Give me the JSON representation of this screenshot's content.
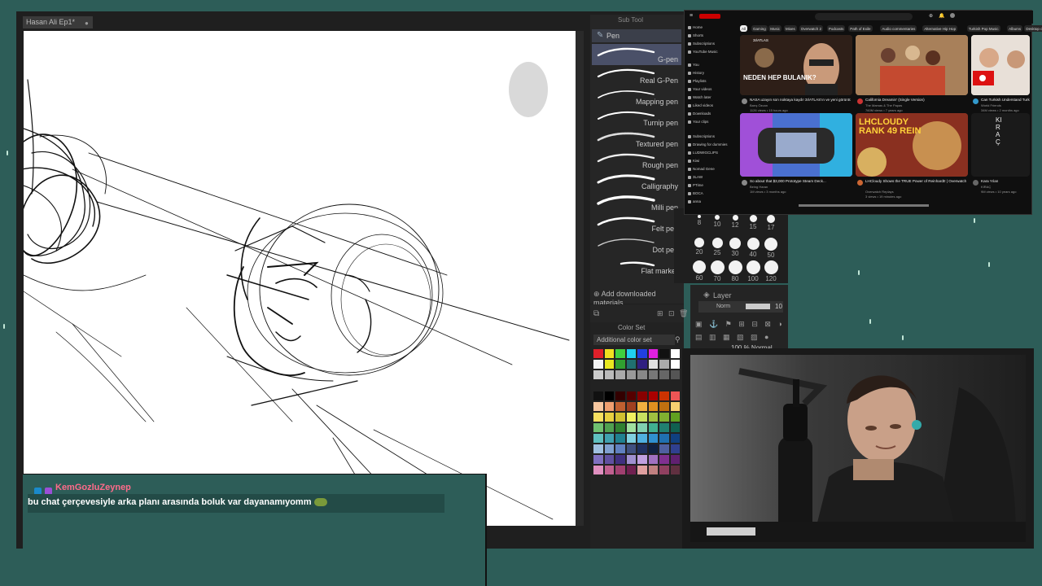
{
  "csp": {
    "document_tab": "Hasan Ali Ep1*",
    "document_tab_close": "●",
    "subtool_title": "Sub Tool",
    "pen_group": "Pen",
    "brushes": [
      {
        "label": "G-pen",
        "selected": true
      },
      {
        "label": "Real G-Pen",
        "selected": false
      },
      {
        "label": "Mapping pen",
        "selected": false
      },
      {
        "label": "Turnip pen",
        "selected": false
      },
      {
        "label": "Textured pen",
        "selected": false
      },
      {
        "label": "Rough pen",
        "selected": false
      },
      {
        "label": "Calligraphy",
        "selected": false
      },
      {
        "label": "Milli pen",
        "selected": false
      },
      {
        "label": "Felt pen",
        "selected": false
      },
      {
        "label": "Dot pen",
        "selected": false
      },
      {
        "label": "Flat marker",
        "selected": false
      }
    ],
    "add_materials": "Add downloaded materials",
    "color_set_title": "Color Set",
    "color_set_name": "Additional color set",
    "brush_sizes": [
      "8",
      "10",
      "12",
      "15",
      "17",
      "20",
      "25",
      "30",
      "40",
      "50",
      "60",
      "70",
      "80",
      "100",
      "120"
    ],
    "layer_title": "Layer",
    "layer_opacity": "100 % Normal",
    "layer_value": "10",
    "layer_blend": "Norm"
  },
  "youtube": {
    "chips": [
      "All",
      "Gaming",
      "Music",
      "Mixes",
      "Overwatch 2",
      "Podcasts",
      "Path of Exile",
      "Audio commentaries",
      "Alternative Hip Hop",
      "Turkish Pop Music",
      "Albums",
      "Desktop computers"
    ],
    "sidebar": [
      "Home",
      "Shorts",
      "Subscriptions",
      "YouTube Music",
      "You",
      "History",
      "Playlists",
      "Your videos",
      "Watch later",
      "Liked videos",
      "Downloads",
      "Your clips",
      "Subscriptions",
      "Drawing for dummies",
      "LUDWIGCLIPS",
      "Kiwi",
      "Nomad Gene",
      "3LAW",
      "PTime",
      "BOCA",
      "anna"
    ],
    "videos": [
      {
        "title": "NASA uzayın son noktaya kaydı! 3I/ATLAS'ın ve yeni görüntüler!",
        "channel": "Barış Özcan",
        "meta": "1126 views • 15 hours ago",
        "thumb_text": "NEDEN HEP BULANIK?",
        "thumb_small": "3I/ATLAS"
      },
      {
        "title": "California Dreamin' (Single Version)",
        "channel": "The Mamas & The Papas",
        "meta": "760M views • 7 years ago",
        "thumb_text": "",
        "thumb_small": ""
      },
      {
        "title": "Can Turkish Understand Turkic They?",
        "channel": "World Friends",
        "meta": "34M views • 2 months ago",
        "thumb_text": "",
        "thumb_small": ""
      },
      {
        "title": "So about that $3,000 Prototype Steam Deck...",
        "channel": "Being Haran",
        "meta": "1M views • 3 months ago",
        "thumb_text": "",
        "thumb_small": ""
      },
      {
        "title": "LHCloudy Shows the TRUE Power of Reinhardt! | Overwatch 2 Season 19 Top 500",
        "channel": "Overwatch Replays",
        "meta": "3 views • 19 minutes ago",
        "thumb_text": "LHCLOUDY RANK 49 REIN",
        "thumb_small": ""
      },
      {
        "title": "Kara Yılan",
        "channel": "KIRAÇ",
        "meta": "9M views • 10 years ago",
        "thumb_text": "KIRAÇ",
        "thumb_small": ""
      }
    ]
  },
  "chat": {
    "username": "KemGozluZeynep",
    "message": "bu chat çerçevesiyle arka planı arasında boluk var dayanamıyomm",
    "username_color": "#ff6b8a"
  },
  "colors": {
    "background": "#2d5d58",
    "panel": "#262626",
    "accent": "#4a5068"
  }
}
